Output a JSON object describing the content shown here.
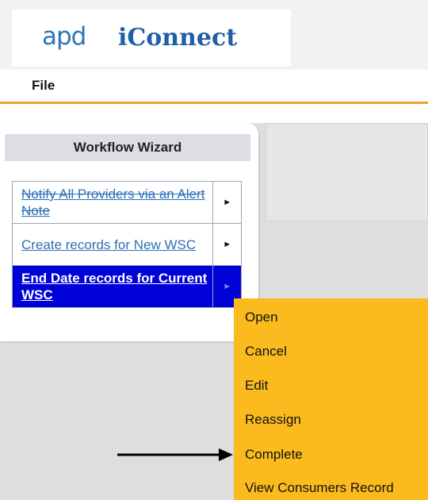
{
  "header": {
    "logo": {
      "apd_text": "apd",
      "brand_text": "iConnect"
    }
  },
  "menubar": {
    "file_label": "File"
  },
  "workflow_wizard": {
    "title": "Workflow Wizard",
    "items": [
      {
        "label": "Notify All Providers via an Alert Note",
        "arrow": "►"
      },
      {
        "label": "Create records for New WSC",
        "arrow": "►"
      },
      {
        "label": "End Date records for Current WSC",
        "arrow": "►"
      }
    ]
  },
  "context_menu": {
    "items": [
      "Open",
      "Cancel",
      "Edit",
      "Reassign",
      "Complete",
      "View Consumers Record"
    ]
  },
  "colors": {
    "accent_orange": "#e8a72a",
    "menu_bg": "#fbbb1e",
    "selected_row": "#0000d8",
    "link_blue": "#2c6fb6"
  }
}
